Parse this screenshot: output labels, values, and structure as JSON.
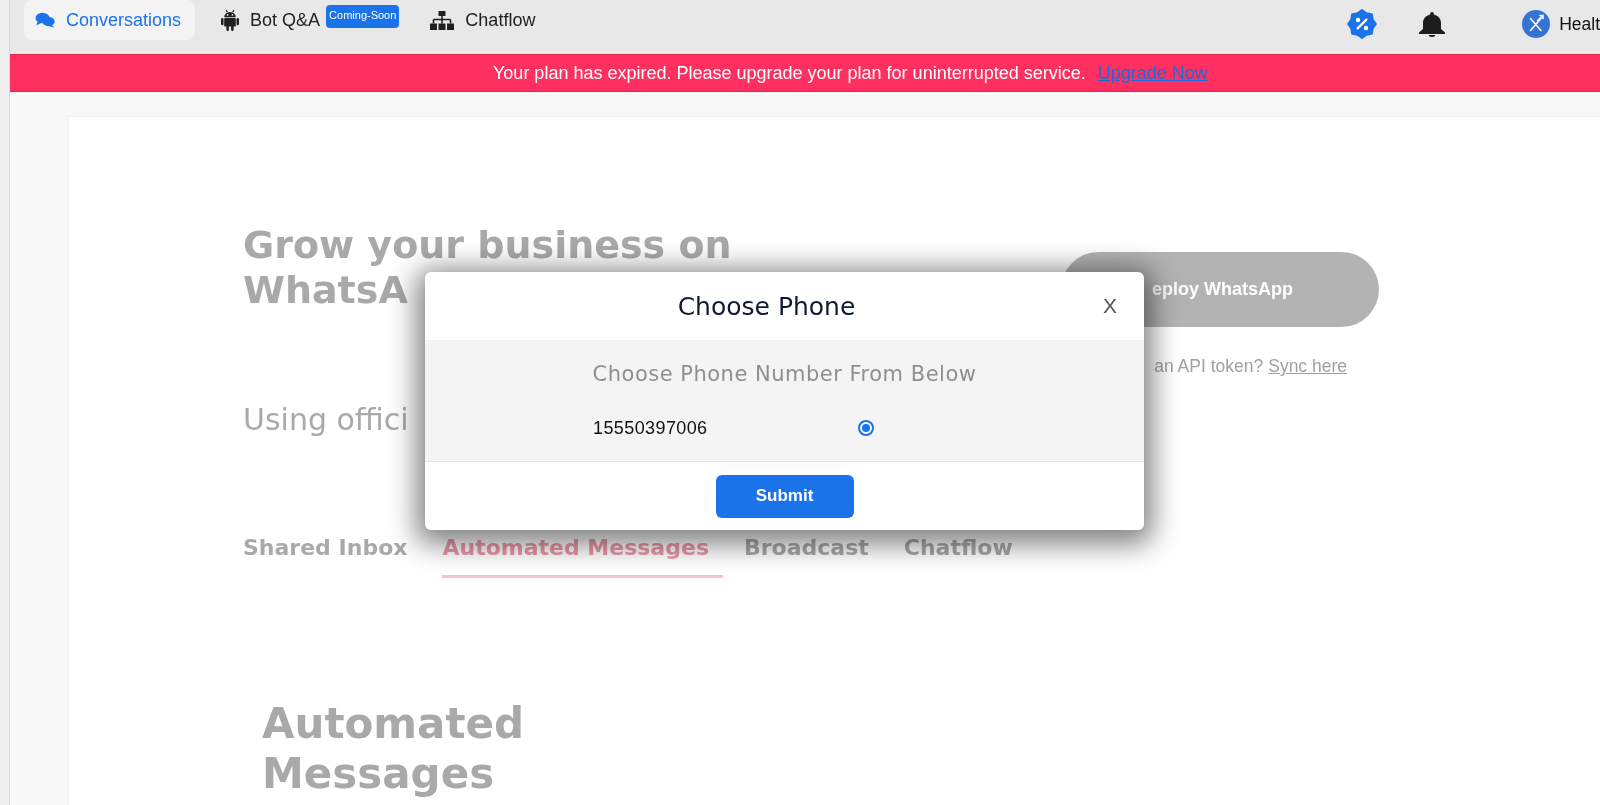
{
  "top_nav": {
    "items": [
      {
        "label": "Conversations",
        "selected": true
      },
      {
        "label": "Bot Q&A",
        "selected": false,
        "badge": "Coming-Soon"
      },
      {
        "label": "Chatflow",
        "selected": false
      }
    ],
    "user_name": "Healt"
  },
  "banner": {
    "message": "Your plan has expired. Please upgrade your plan for uninterrupted service.",
    "link": "Upgrade Now"
  },
  "hero": {
    "heading_lines": [
      "Grow your business on",
      "WhatsA"
    ],
    "subtitle": "Using offici",
    "deploy_button": "eploy WhatsApp",
    "sync_prompt": "an API token?",
    "sync_link": "Sync here"
  },
  "feature_tabs": [
    {
      "label": "Shared Inbox",
      "selected": false
    },
    {
      "label": "Automated Messages",
      "selected": true
    },
    {
      "label": "Broadcast",
      "selected": false
    },
    {
      "label": "Chatflow",
      "selected": false
    }
  ],
  "section_heading": "Automated Messages",
  "dialog": {
    "title": "Choose Phone",
    "close": "X",
    "prompt": "Choose Phone Number From Below",
    "phones": [
      {
        "number": "15550397006",
        "selected": true
      }
    ],
    "submit": "Submit"
  }
}
